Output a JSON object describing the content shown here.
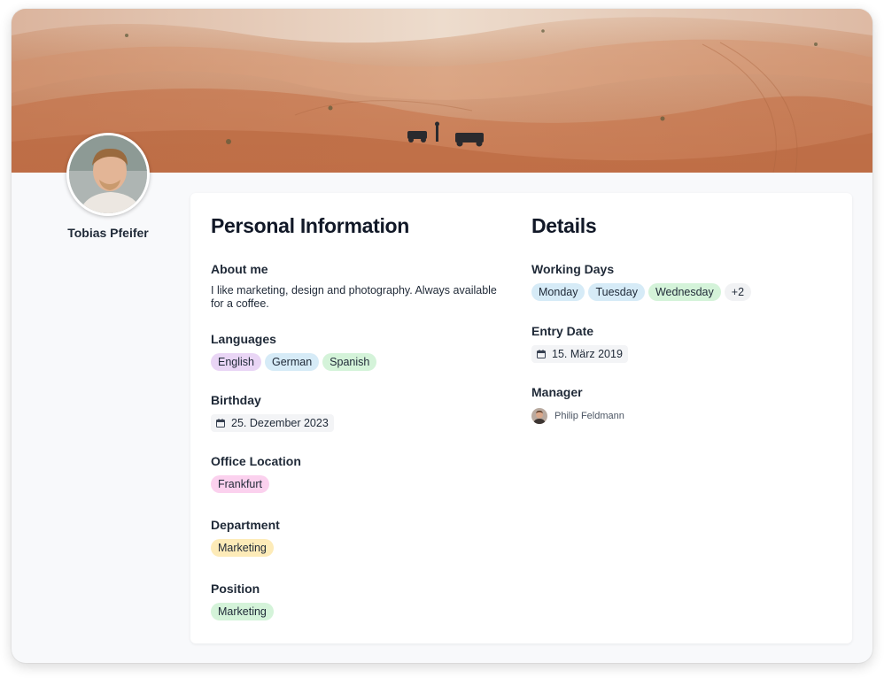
{
  "profile": {
    "name": "Tobias Pfeifer"
  },
  "personal": {
    "title": "Personal Information",
    "about": {
      "label": "About me",
      "text": "I like marketing, design and photography. Always available for a coffee."
    },
    "languages": {
      "label": "Languages",
      "items": [
        {
          "text": "English",
          "color": "#e9d5f5"
        },
        {
          "text": "German",
          "color": "#d6ebf7"
        },
        {
          "text": "Spanish",
          "color": "#d4f3d9"
        }
      ]
    },
    "birthday": {
      "label": "Birthday",
      "date": "25. Dezember 2023",
      "icon": "calendar-icon"
    },
    "office": {
      "label": "Office Location",
      "value": "Frankfurt",
      "color": "#fbd1ee"
    },
    "department": {
      "label": "Department",
      "value": "Marketing",
      "color": "#fdebb8"
    },
    "position": {
      "label": "Position",
      "value": "Marketing",
      "color": "#d4f3d9"
    }
  },
  "details": {
    "title": "Details",
    "working_days": {
      "label": "Working Days",
      "items": [
        {
          "text": "Monday",
          "color": "#d6ebf7"
        },
        {
          "text": "Tuesday",
          "color": "#d6ebf7"
        },
        {
          "text": "Wednesday",
          "color": "#d4f3d9"
        },
        {
          "text": "+2",
          "color": "#f1f2f4"
        }
      ]
    },
    "entry_date": {
      "label": "Entry Date",
      "date": "15. März 2019",
      "icon": "calendar-icon"
    },
    "manager": {
      "label": "Manager",
      "name": "Philip Feldmann"
    }
  }
}
